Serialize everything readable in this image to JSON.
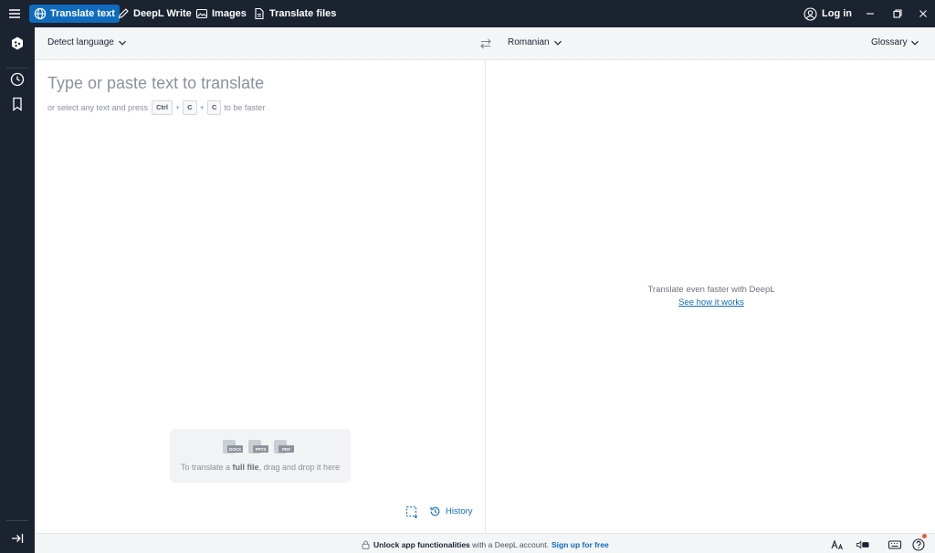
{
  "topbar": {
    "tabs": [
      {
        "label": "Translate text",
        "icon": "globe-icon",
        "active": true
      },
      {
        "label": "DeepL Write",
        "icon": "pen-icon",
        "active": false
      },
      {
        "label": "Images",
        "icon": "image-icon",
        "active": false
      },
      {
        "label": "Translate files",
        "icon": "file-icon",
        "active": false
      }
    ],
    "login_label": "Log in"
  },
  "langbar": {
    "source_language": "Detect language",
    "target_language": "Romanian",
    "glossary_label": "Glossary"
  },
  "source": {
    "placeholder": "Type or paste text to translate",
    "hint_prefix": "or select any text and press",
    "keys": [
      "Ctrl",
      "C",
      "C"
    ],
    "key_separator": "+",
    "hint_suffix": "to be faster"
  },
  "dropzone": {
    "file_types": [
      "DOCX",
      "PPTX",
      "PDF"
    ],
    "text_before": "To translate a",
    "text_bold": "full file",
    "text_after": ", drag and drop it here"
  },
  "history_label": "History",
  "target": {
    "promo_text": "Translate even faster with DeepL",
    "promo_link": "See how it works"
  },
  "footer": {
    "bold_text": "Unlock app functionalities",
    "text": "with a DeepL account.",
    "signup_label": "Sign up for free"
  },
  "colors": {
    "chrome": "#1b2230",
    "accent": "#0f6bbd",
    "notification": "#e55b3c"
  }
}
